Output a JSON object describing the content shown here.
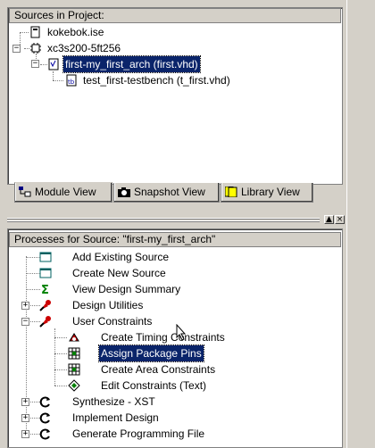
{
  "sources": {
    "header": "Sources in Project:",
    "items": [
      {
        "label": "kokebok.ise",
        "icon": "project-file-icon"
      },
      {
        "label": "xc3s200-5ft256",
        "icon": "chip-icon"
      },
      {
        "label": "first-my_first_arch (first.vhd)",
        "icon": "vhdl-file-icon",
        "selected": true
      },
      {
        "label": "test_first-testbench (t_first.vhd)",
        "icon": "testbench-file-icon"
      }
    ],
    "tabs": [
      {
        "label": "Module View",
        "icon": "module-view-icon",
        "active": true
      },
      {
        "label": "Snapshot View",
        "icon": "camera-icon"
      },
      {
        "label": "Library View",
        "icon": "library-icon"
      }
    ]
  },
  "splitter": {
    "minimize_glyph": "▲",
    "close_glyph": "×"
  },
  "processes": {
    "header": "Processes for Source:  \"first-my_first_arch\"",
    "items": [
      {
        "label": "Add Existing Source",
        "icon": "document-icon"
      },
      {
        "label": "Create New Source",
        "icon": "document-icon"
      },
      {
        "label": "View Design Summary",
        "icon": "sigma-icon"
      },
      {
        "label": "Design Utilities",
        "icon": "tools-icon",
        "expander": "+"
      },
      {
        "label": "User Constraints",
        "icon": "tools-icon",
        "expander": "−"
      },
      {
        "label": "Create Timing Constraints",
        "icon": "timing-icon"
      },
      {
        "label": "Assign Package Pins",
        "icon": "grid-icon",
        "selected": true
      },
      {
        "label": "Create Area Constraints",
        "icon": "grid-icon"
      },
      {
        "label": "Edit Constraints (Text)",
        "icon": "edit-icon"
      },
      {
        "label": "Synthesize - XST",
        "icon": "cycle-icon",
        "expander": "+"
      },
      {
        "label": "Implement Design",
        "icon": "cycle-icon",
        "expander": "+"
      },
      {
        "label": "Generate Programming File",
        "icon": "cycle-icon",
        "expander": "+"
      }
    ]
  },
  "colors": {
    "selection": "#0a246a",
    "face": "#d4d0c8"
  }
}
